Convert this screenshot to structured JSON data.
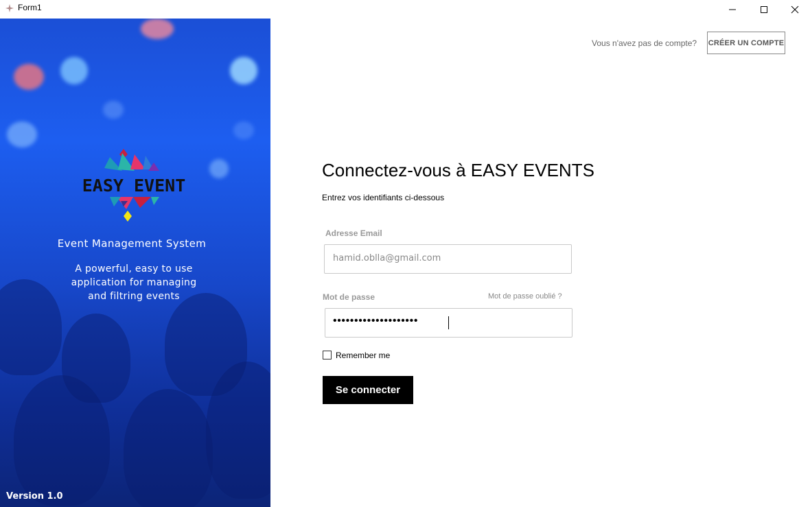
{
  "window": {
    "title": "Form1"
  },
  "hero": {
    "logo_text": "EASY EVENT",
    "heading": "Event Management System",
    "tagline": "A powerful, easy to use application for managing and filtring events",
    "version": "Version 1.0"
  },
  "account": {
    "prompt": "Vous n'avez pas de compte?",
    "create_label": "CRÉER UN COMPTE"
  },
  "form": {
    "title": "Connectez-vous à EASY EVENTS",
    "subtitle": "Entrez vos identifiants ci-dessous",
    "email_label": "Adresse Email",
    "email_value": "hamid.oblla@gmail.com",
    "password_label": "Mot de passe",
    "forgot_label": "Mot de passe oublié ?",
    "password_value": "••••••••••••••••••••",
    "remember_label": "Remember me",
    "remember_checked": false,
    "submit_label": "Se connecter"
  },
  "colors": {
    "hero_blue": "#1d5ef0",
    "button_bg": "#000000",
    "muted_label": "#999999"
  }
}
